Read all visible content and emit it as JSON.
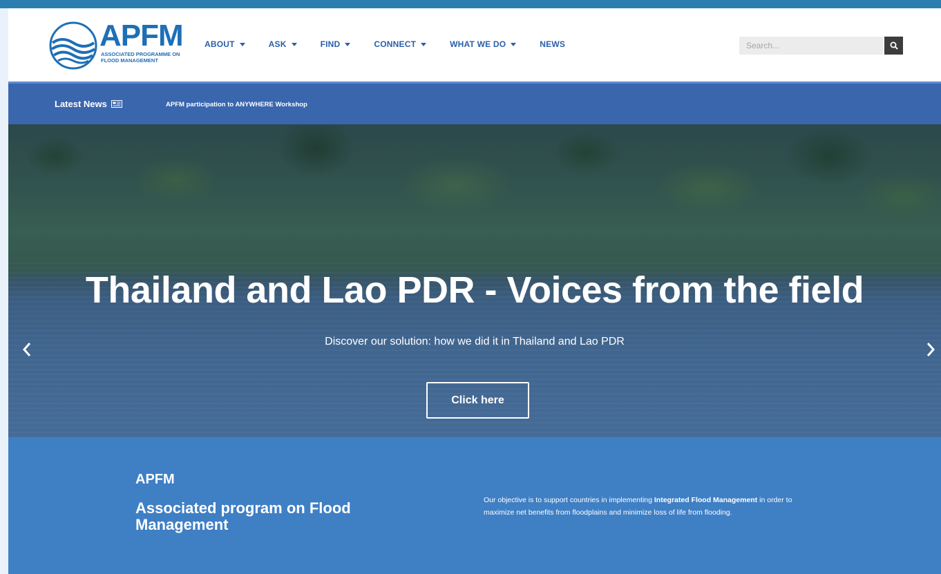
{
  "brand": {
    "logo_title": "APFM",
    "logo_subtitle": "Associated Programme on Flood Management",
    "accent_color": "#1e6fb6"
  },
  "nav": {
    "items": [
      {
        "label": "ABOUT",
        "has_dropdown": true
      },
      {
        "label": "ASK",
        "has_dropdown": true
      },
      {
        "label": "FIND",
        "has_dropdown": true
      },
      {
        "label": "CONNECT",
        "has_dropdown": true
      },
      {
        "label": "WHAT WE DO",
        "has_dropdown": true
      },
      {
        "label": "NEWS",
        "has_dropdown": false
      }
    ]
  },
  "search": {
    "placeholder": "Search...",
    "button_icon": "search-icon"
  },
  "ticker": {
    "label": "Latest News",
    "label_icon": "newspaper-icon",
    "headline": "APFM participation to ANYWHERE Workshop"
  },
  "hero": {
    "title": "Thailand and Lao PDR - Voices from the field",
    "subtitle": "Discover our solution: how we did it in Thailand and Lao PDR",
    "button_label": "Click here",
    "prev_icon": "chevron-left-icon",
    "next_icon": "chevron-right-icon"
  },
  "about": {
    "brand": "APFM",
    "heading": "Associated program on Flood Management",
    "text_before": "Our objective is to support countries in implementing ",
    "text_bold": "Integrated Flood Management",
    "text_after": " in order to maximize net benefits from floodplains and minimize loss of life from flooding.",
    "background_color": "#3f7fc4"
  }
}
